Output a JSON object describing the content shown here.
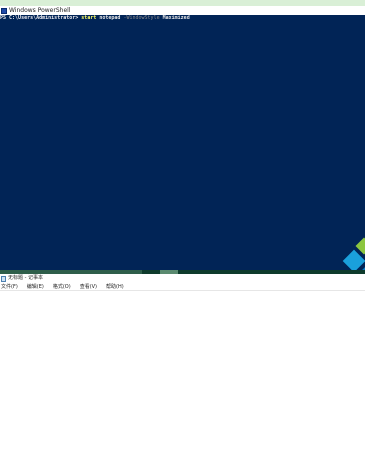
{
  "top_strip": {
    "color": "#d9efd6"
  },
  "powershell": {
    "title": "Windows PowerShell",
    "background": "#012456",
    "command_line": {
      "prompt": "PS C:\\Users\\Administrator>",
      "command": "start",
      "argument": "notepad",
      "parameter": "-WindowStyle",
      "value": "Maximized"
    }
  },
  "notepad": {
    "title": "无标题 - 记事本",
    "menu": [
      {
        "label": "文件(F)"
      },
      {
        "label": "编辑(E)"
      },
      {
        "label": "格式(O)"
      },
      {
        "label": "查看(V)"
      },
      {
        "label": "帮助(H)"
      }
    ],
    "content": ""
  },
  "icons": {
    "powershell_icon": "powershell-icon",
    "notepad_icon": "notepad-icon"
  }
}
